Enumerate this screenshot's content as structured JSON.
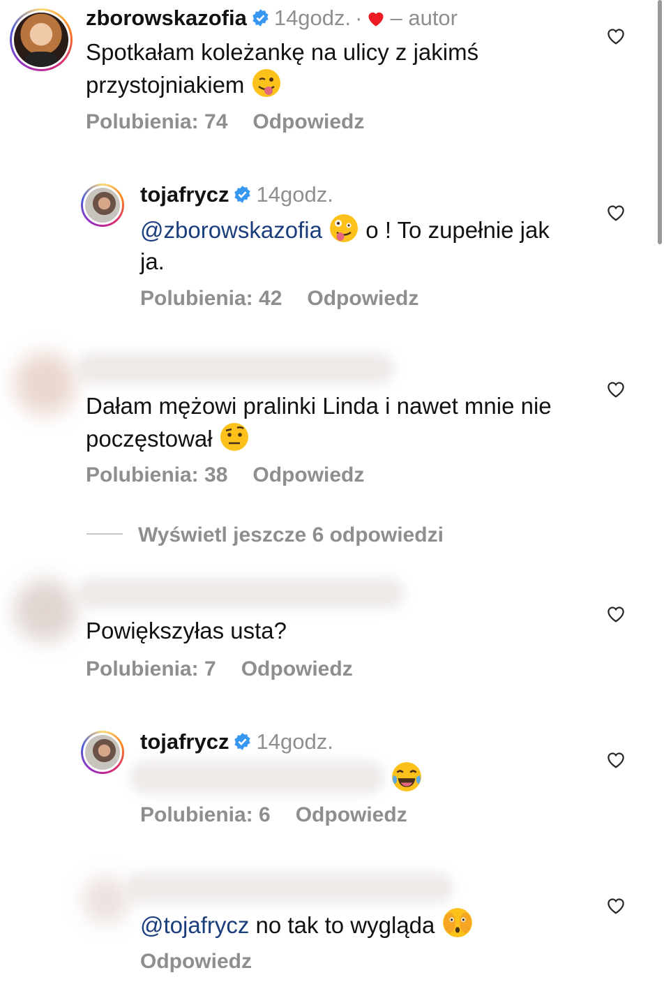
{
  "comments": [
    {
      "username": "zborowskazofia",
      "time": "14godz.",
      "separator": "·",
      "author_label": "– autor",
      "text": "Spotkałam koleżankę na ulicy z jakimś przystojniakiem",
      "likes": "Polubienia: 74",
      "reply": "Odpowiedz"
    },
    {
      "username": "tojafrycz",
      "time": "14godz.",
      "mention": "@zborowskazofia",
      "text_after": " o ! To zupełnie jak ja.",
      "likes": "Polubienia: 42",
      "reply": "Odpowiedz"
    },
    {
      "text": "Dałam mężowi pralinki Linda i nawet mnie nie poczęstował",
      "likes": "Polubienia: 38",
      "reply": "Odpowiedz"
    },
    {
      "text": "Powiększyłas usta?",
      "likes": "Polubienia: 7",
      "reply": "Odpowiedz"
    },
    {
      "username": "tojafrycz",
      "time": "14godz.",
      "likes": "Polubienia: 6",
      "reply": "Odpowiedz"
    },
    {
      "mention": "@tojafrycz",
      "text": " no tak to wygląda",
      "reply": "Odpowiedz"
    }
  ],
  "view_more": "Wyświetl jeszcze 6 odpowiedzi",
  "colors": {
    "verified": "#3897f0",
    "liked_heart": "#ed1c24",
    "muted": "#8e8e8e",
    "mention": "#1a3d7c"
  },
  "icons": [
    "verified-badge-icon",
    "heart-icon",
    "like-heart-icon",
    "emoji"
  ]
}
